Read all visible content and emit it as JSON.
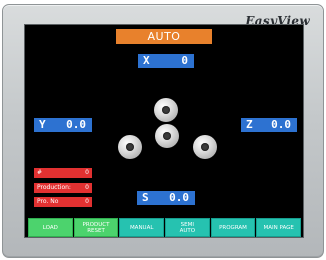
{
  "brand": "EasyView",
  "screen_title": "AUTO",
  "axes": {
    "x": {
      "label": "X",
      "value": "0"
    },
    "y": {
      "label": "Y",
      "value": "0.0"
    },
    "z": {
      "label": "Z",
      "value": "0.0"
    },
    "s": {
      "label": "S",
      "value": "0.0"
    }
  },
  "counters": [
    {
      "label": "#",
      "value": "0"
    },
    {
      "label": "Production:",
      "value": "0"
    },
    {
      "label": "Pro. No",
      "value": "0"
    }
  ],
  "buttons": [
    {
      "label": "LOAD",
      "active": true
    },
    {
      "label": "PRODUCT\nRESET",
      "active": true
    },
    {
      "label": "MANUAL",
      "active": false
    },
    {
      "label": "SEMI\nAUTO",
      "active": false
    },
    {
      "label": "PROGRAM",
      "active": false
    },
    {
      "label": "MAIN PAGE",
      "active": false
    }
  ],
  "colors": {
    "title_bar": "#e8812c",
    "axis_display": "#2d72d1",
    "counter": "#e23131",
    "button": "#26c2b0",
    "button_active": "#4cd36d"
  }
}
